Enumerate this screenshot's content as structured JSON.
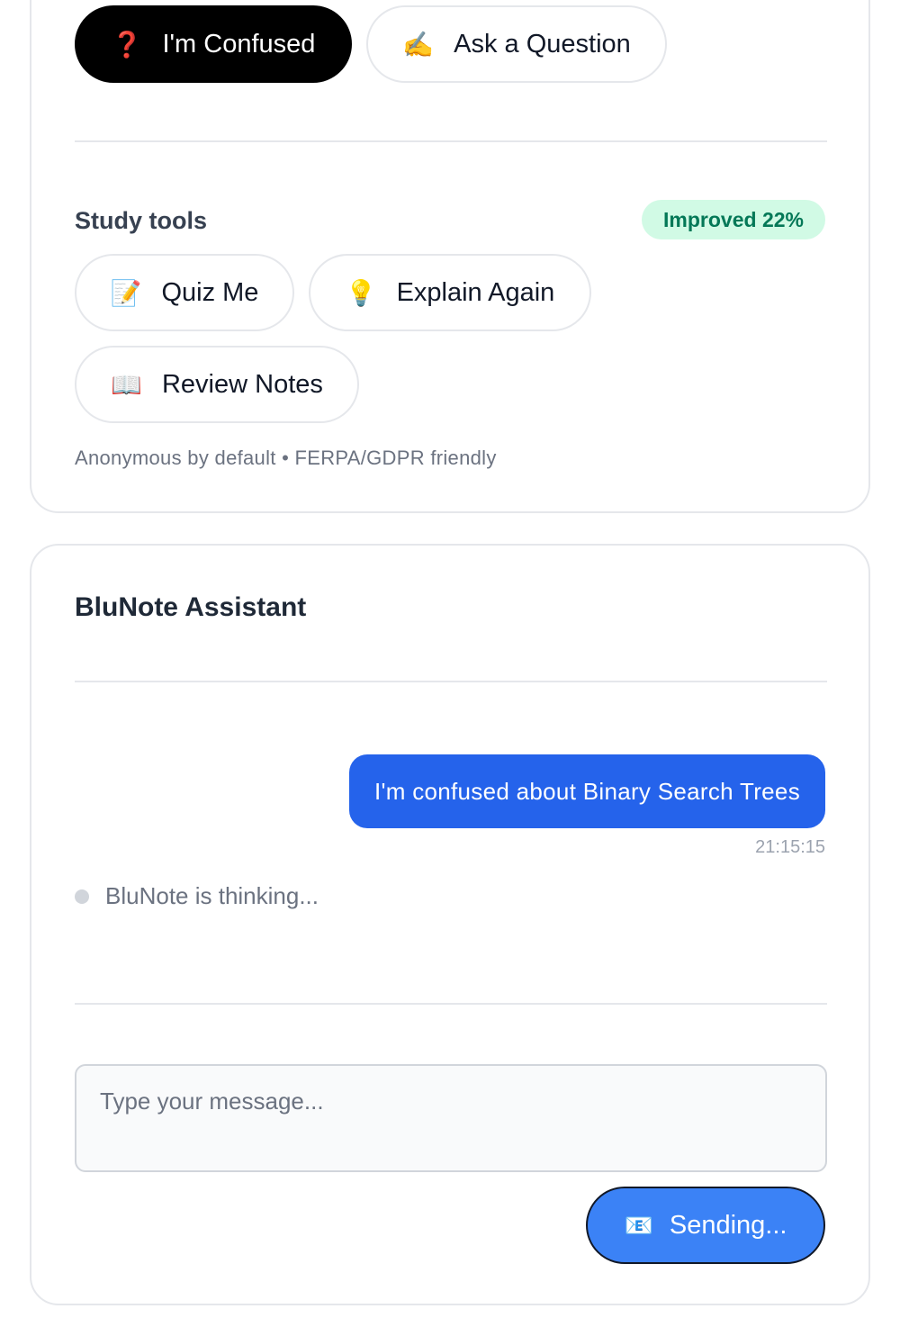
{
  "actions": {
    "confused": {
      "icon": "question-mark-icon",
      "glyph": "❓",
      "label": "I'm Confused"
    },
    "ask": {
      "icon": "writing-hand-icon",
      "glyph": "✍️",
      "label": "Ask a Question"
    }
  },
  "study_tools": {
    "title": "Study tools",
    "badge": "Improved 22%",
    "quiz": {
      "icon": "memo-icon",
      "glyph": "📝",
      "label": "Quiz Me"
    },
    "explain": {
      "icon": "lightbulb-icon",
      "glyph": "💡",
      "label": "Explain Again"
    },
    "review": {
      "icon": "open-book-icon",
      "glyph": "📖",
      "label": "Review Notes"
    },
    "privacy_note": "Anonymous by default • FERPA/GDPR friendly"
  },
  "chat": {
    "title": "BluNote Assistant",
    "messages": [
      {
        "sender": "user",
        "text": "I'm confused about Binary Search Trees",
        "time": "21:15:15"
      }
    ],
    "status": "BluNote is thinking...",
    "input_placeholder": "Type your message...",
    "input_value": "",
    "send": {
      "icon": "envelope-icon",
      "glyph": "📧",
      "label": "Sending..."
    }
  },
  "colors": {
    "accent": "#2563eb",
    "send_button": "#3b82f6",
    "badge_bg": "#d1fae5",
    "badge_text": "#047857"
  }
}
